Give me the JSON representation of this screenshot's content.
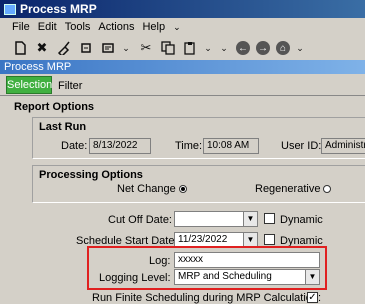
{
  "window": {
    "title": "Process MRP"
  },
  "menu": {
    "items": [
      "File",
      "Edit",
      "Tools",
      "Actions",
      "Help"
    ],
    "more": "⌄"
  },
  "form": {
    "title": "Process MRP"
  },
  "tabs": {
    "selection": "Selection",
    "filter": "Filter"
  },
  "report_options": {
    "heading": "Report Options"
  },
  "last_run": {
    "heading": "Last Run",
    "date_label": "Date:",
    "date_value": "8/13/2022",
    "time_label": "Time:",
    "time_value": "10:08 AM",
    "user_label": "User ID:",
    "user_value": "Administrat"
  },
  "processing": {
    "heading": "Processing Options",
    "net_change_label": "Net Change",
    "net_change_selected": true,
    "regenerative_label": "Regenerative",
    "regenerative_selected": false
  },
  "cutoff": {
    "label": "Cut Off Date:",
    "value": "",
    "dynamic_label": "Dynamic",
    "dynamic_checked": false
  },
  "schedule_start": {
    "label": "Schedule Start Date:",
    "value": "11/23/2022",
    "dynamic_label": "Dynamic",
    "dynamic_checked": false
  },
  "log": {
    "label": "Log:",
    "value": "xxxxx"
  },
  "logging_level": {
    "label": "Logging Level:",
    "value": "MRP and Scheduling"
  },
  "finite": {
    "label": "Run Finite Scheduling during MRP Calculation:",
    "checked": true
  },
  "colors": {
    "highlight": "#e02020",
    "tab_selected": "#40b040",
    "title_bar": "#0a246a"
  },
  "toolbar_icons": [
    "new-icon",
    "delete-icon",
    "clear-icon",
    "attachment-icon",
    "print-preview-icon",
    "cut-icon",
    "copy-icon",
    "paste-icon",
    "back-icon",
    "forward-icon",
    "home-icon"
  ]
}
